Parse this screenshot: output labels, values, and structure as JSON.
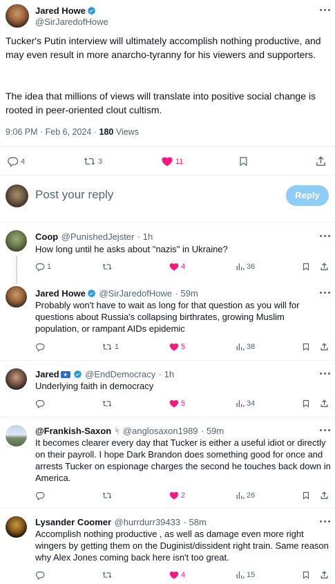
{
  "main_tweet": {
    "author_name": "Jared Howe",
    "author_handle": "@SirJaredofHowe",
    "paragraph1": "Tucker's Putin interview will ultimately accomplish nothing productive, and may even result in more anarcho-tyranny for his viewers and supporters.",
    "paragraph2": "The idea that millions of views will translate into positive social change is rooted in peer-oriented clout cultism.",
    "time": "9:06 PM · Feb 6, 2024 · ",
    "views_count": "180",
    "views_label": " Views",
    "stats": {
      "replies": "4",
      "retweets": "3",
      "likes": "11"
    }
  },
  "composer": {
    "placeholder": "Post your reply",
    "button_label": "Reply"
  },
  "replies": [
    {
      "name": "Coop",
      "handle": "@PunishedJejster",
      "time": "· 1h",
      "text": "How long until he asks about \"nazis\" in Ukraine?",
      "replies": "1",
      "retweets": "",
      "likes": "4",
      "views": "36"
    },
    {
      "name": "Jared Howe",
      "handle": "@SirJaredofHowe",
      "time": "· 59m",
      "text": "Probably won't have to wait as long for that question as you will for questions about Russia's collapsing birthrates, growing Muslim population, or rampant AIDs epidemic",
      "replies": "",
      "retweets": "1",
      "likes": "5",
      "views": "38"
    },
    {
      "name": "Jared",
      "handle": "@EndDemocracy",
      "time": "· 1h",
      "text": "Underlying faith in democracy",
      "replies": "",
      "retweets": "",
      "likes": "5",
      "views": "34"
    },
    {
      "name": "@Frankish-Saxon",
      "name_glyph": "ᛋ",
      "handle": "@anglosaxon1989",
      "time": "· 59m",
      "text": "It becomes clearer every day that Tucker is either a useful idiot or directly on their payroll. I hope Dark Brandon does something good for once and arrests Tucker on espionage charges the second he touches back down in America.",
      "replies": "",
      "retweets": "",
      "likes": "2",
      "views": "26"
    },
    {
      "name": "Lysander Coomer",
      "handle": "@hurrdurr39433",
      "time": "· 58m",
      "text": "Accomplish nothing productive , as well as damage even more right wingers by getting them on the Duginist/dissident right train. Same reason why Alex Jones coming back here isn't too great.",
      "replies": "",
      "retweets": "",
      "likes": "4",
      "views": "15"
    }
  ],
  "colors": {
    "like": "#f91880",
    "verified": "#1d9bf0",
    "reply_button": "#8ecdf8",
    "muted": "#536471"
  }
}
